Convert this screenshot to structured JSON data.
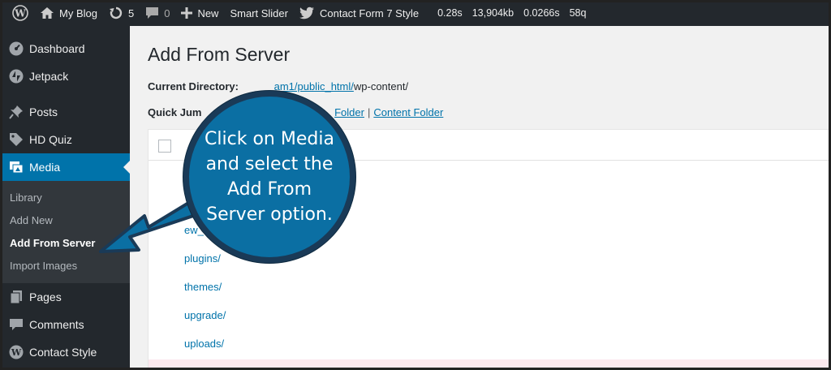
{
  "adminbar": {
    "site_name": "My Blog",
    "updates_count": "5",
    "comments_count": "0",
    "new_label": "New",
    "smart_slider_label": "Smart Slider",
    "contact_form_label": "Contact Form 7 Style",
    "stat_time": "0.28s",
    "stat_memory": "13,904kb",
    "stat_query_time": "0.0266s",
    "stat_queries": "58q"
  },
  "sidebar": {
    "items": [
      {
        "label": "Dashboard",
        "icon": "dashboard-icon"
      },
      {
        "label": "Jetpack",
        "icon": "jetpack-icon"
      },
      {
        "label": "Posts",
        "icon": "pin-icon"
      },
      {
        "label": "HD Quiz",
        "icon": "tag-icon"
      },
      {
        "label": "Media",
        "icon": "media-icon"
      },
      {
        "label": "Pages",
        "icon": "pages-icon"
      },
      {
        "label": "Comments",
        "icon": "comment-icon"
      },
      {
        "label": "Contact Style",
        "icon": "wordpress-icon"
      }
    ],
    "media_submenu": [
      "Library",
      "Add New",
      "Add From Server",
      "Import Images"
    ]
  },
  "main": {
    "title": "Add From Server",
    "current_directory_label": "Current Directory:",
    "current_directory_path_visible": "am1/public_html/",
    "current_directory_path_tail": "wp-content/",
    "quick_jump_label": "Quick Jum",
    "quick_jump_link1": "Folder",
    "quick_jump_link2": "Content Folder",
    "rows": [
      "ew_ba",
      "plugins/",
      "themes/",
      "upgrade/",
      "uploads/"
    ]
  },
  "callout": {
    "text_line1": "Click on Media",
    "text_line2": "and select the",
    "text_line3": "Add From",
    "text_line4": "Server option.",
    "colors": {
      "circle": "#0b6fa3",
      "border": "#1a3a57",
      "arrow": "#0b6fa3"
    }
  },
  "colors": {
    "adminbar_bg": "#23282d",
    "sidebar_bg": "#23282d",
    "active_menu": "#0073aa",
    "link": "#0073aa"
  }
}
